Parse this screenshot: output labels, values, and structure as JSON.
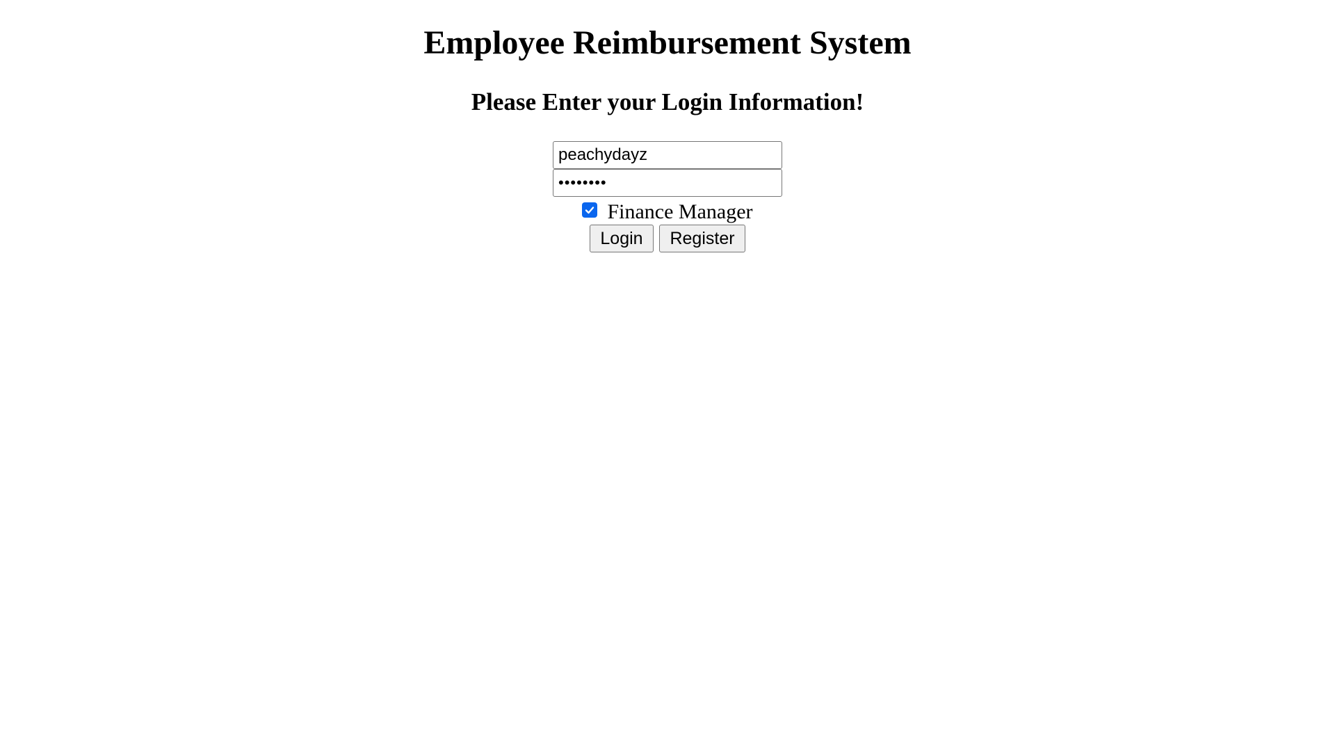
{
  "page": {
    "title": "Employee Reimbursement System",
    "subtitle": "Please Enter your Login Information!"
  },
  "login_form": {
    "username_value": "peachydayz",
    "password_value": "••••••••",
    "finance_manager": {
      "label": "Finance Manager",
      "checked": true
    },
    "login_label": "Login",
    "register_label": "Register"
  },
  "colors": {
    "checkbox_accent": "#0a66ee",
    "button_bg": "#efefef",
    "border": "#767676"
  },
  "icons": {
    "checkbox": "checkmark-icon"
  }
}
